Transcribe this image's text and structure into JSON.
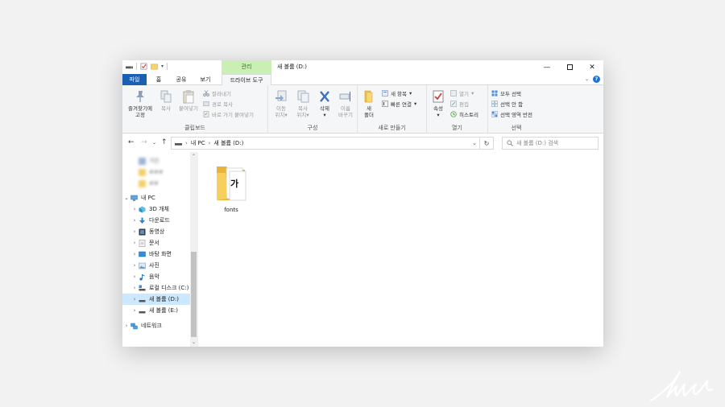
{
  "window": {
    "title": "새 볼륨 (D:)",
    "context_tab_header": "관리"
  },
  "tabs": [
    {
      "label": "파일"
    },
    {
      "label": "홈"
    },
    {
      "label": "공유"
    },
    {
      "label": "보기"
    },
    {
      "label": "드라이브 도구"
    }
  ],
  "ribbon": {
    "clipboard": {
      "label": "클립보드",
      "pin": "즐겨찾기에\n고정",
      "copy": "복사",
      "paste": "붙여넣기",
      "cut": "잘라내기",
      "copy_path": "경로 복사",
      "paste_shortcut": "바로 가기 붙여넣기"
    },
    "organize": {
      "label": "구성",
      "move_to": "이동\n위치",
      "copy_to": "복사\n위치",
      "delete": "삭제",
      "rename": "이름\n바꾸기"
    },
    "new": {
      "label": "새로 만들기",
      "new_folder": "새\n폴더",
      "new_item": "새 항목",
      "easy_access": "빠른 연결"
    },
    "open": {
      "label": "열기",
      "properties": "속성",
      "open": "열기",
      "edit": "편집",
      "history": "히스토리"
    },
    "select": {
      "label": "선택",
      "select_all": "모두 선택",
      "select_none": "선택 안 함",
      "invert": "선택 영역 반전"
    }
  },
  "address": {
    "crumbs": [
      "내 PC",
      "새 볼륨 (D:)"
    ],
    "search_placeholder": "새 볼륨 (D:) 검색"
  },
  "nav_tree": {
    "blurred_items": [
      "가든",
      "###",
      "##"
    ],
    "pc_label": "내 PC",
    "children": [
      {
        "label": "3D 개체",
        "icon": "3d-objects-icon"
      },
      {
        "label": "다운로드",
        "icon": "download-icon"
      },
      {
        "label": "동영상",
        "icon": "video-icon"
      },
      {
        "label": "문서",
        "icon": "document-icon"
      },
      {
        "label": "바탕 화면",
        "icon": "desktop-icon"
      },
      {
        "label": "사진",
        "icon": "picture-icon"
      },
      {
        "label": "음악",
        "icon": "music-icon"
      },
      {
        "label": "로컬 디스크 (C:)",
        "icon": "drive-icon"
      },
      {
        "label": "새 볼륨 (D:)",
        "icon": "drive-icon",
        "selected": true
      },
      {
        "label": "새 볼륨 (E:)",
        "icon": "drive-icon"
      }
    ],
    "network_label": "네트워크"
  },
  "files": [
    {
      "name": "fonts",
      "glyph": "가"
    }
  ],
  "colors": {
    "file_tab": "#1a5fb4",
    "context_tab": "#c9efb4",
    "selection": "#cce8ff"
  }
}
